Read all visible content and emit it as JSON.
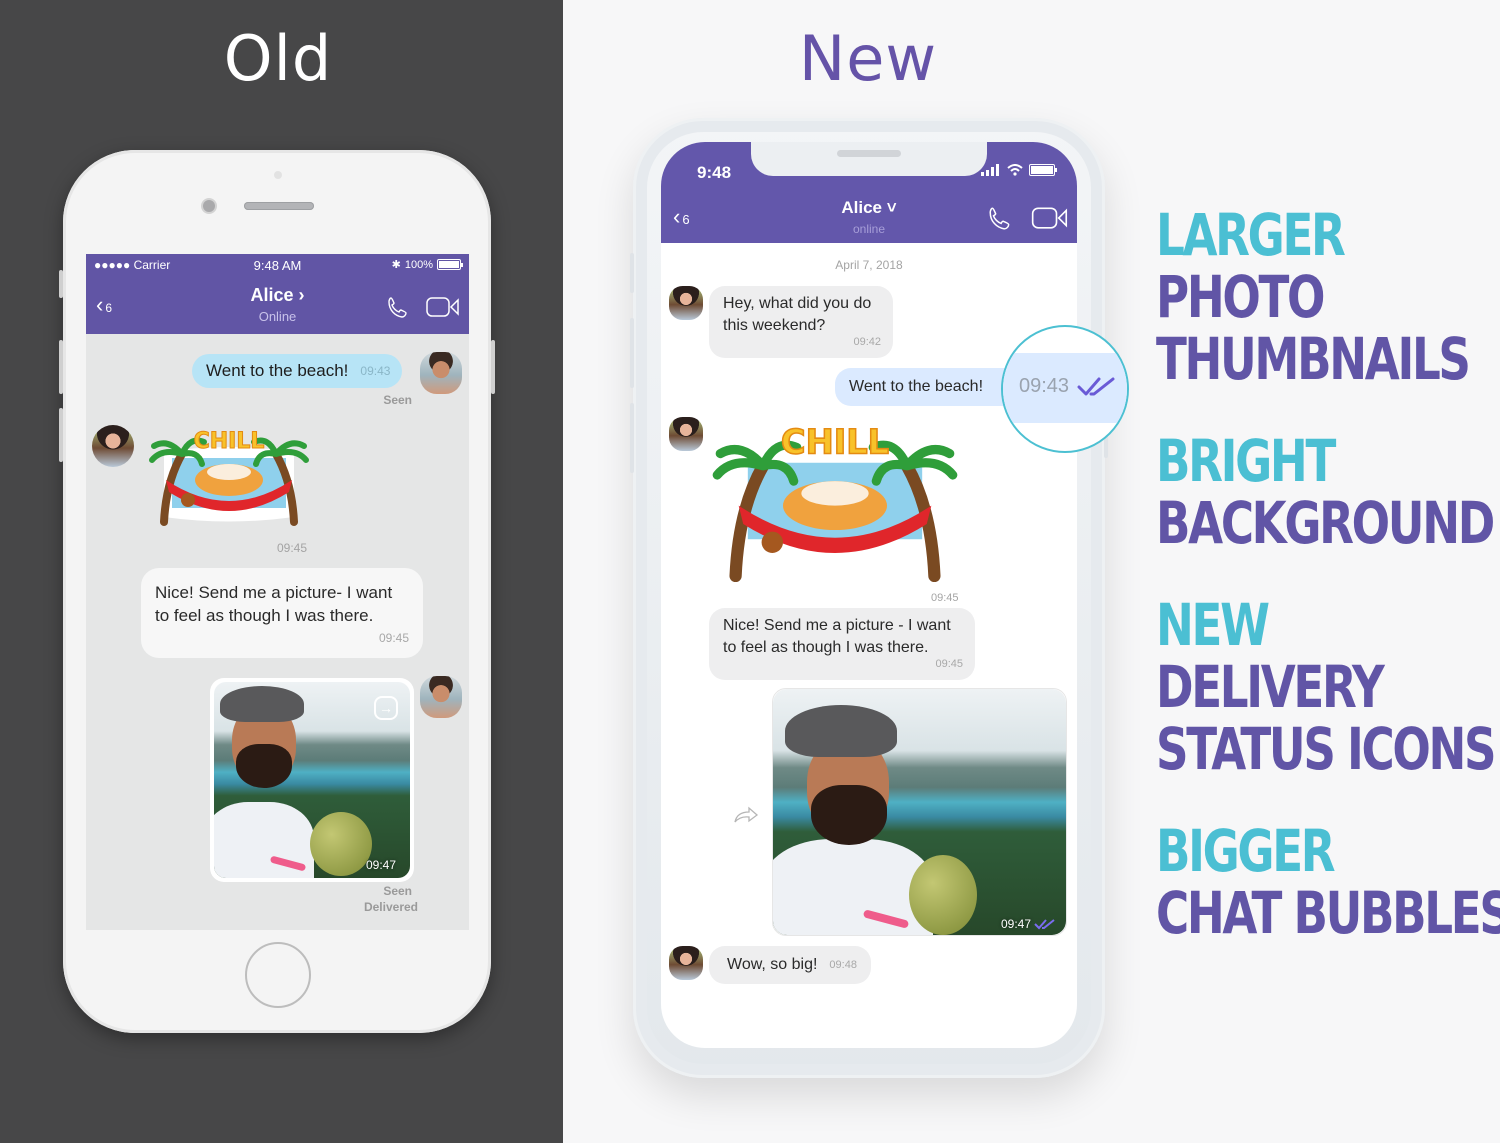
{
  "old": {
    "title": "Old",
    "statusbar": {
      "carrier": "●●●●● Carrier",
      "time": "9:48 AM",
      "bluetooth": "✱",
      "battery": "100%"
    },
    "navbar": {
      "back_count": "6",
      "contact": "Alice ›",
      "status": "Online"
    },
    "messages": [
      {
        "type": "text",
        "direction": "out",
        "text": "Went to the beach!",
        "time": "09:43",
        "status": "Seen"
      },
      {
        "type": "sticker",
        "direction": "in",
        "sticker": "CHILL",
        "time": "09:45"
      },
      {
        "type": "text",
        "direction": "in",
        "text": "Nice! Send me a picture- I want to feel as though I was there.",
        "time": "09:45"
      },
      {
        "type": "photo",
        "direction": "out",
        "time": "09:47",
        "status_lines": [
          "Seen",
          "Delivered"
        ]
      }
    ]
  },
  "new": {
    "title": "New",
    "statusbar": {
      "time": "9:48"
    },
    "navbar": {
      "back_count": "6",
      "contact": "Alice ˅",
      "status": "online"
    },
    "date_separator": "April 7, 2018",
    "messages": [
      {
        "type": "text",
        "direction": "in",
        "text": "Hey, what did you do this weekend?",
        "time": "09:42"
      },
      {
        "type": "text",
        "direction": "out",
        "text": "Went to the beach!",
        "time": "09:43",
        "status": "seen-double-check"
      },
      {
        "type": "sticker",
        "direction": "in",
        "sticker": "CHILL",
        "time": "09:45"
      },
      {
        "type": "text",
        "direction": "in",
        "text": "Nice! Send me a picture - I want to feel as though I was there.",
        "time": "09:45"
      },
      {
        "type": "photo",
        "direction": "out",
        "time": "09:47",
        "status": "seen-double-check"
      },
      {
        "type": "text",
        "direction": "in",
        "text": "Wow, so big!",
        "time": "09:48"
      }
    ],
    "magnifier": {
      "time": "09:43"
    }
  },
  "features": [
    {
      "accent": "LARGER",
      "lines": [
        "PHOTO",
        "THUMBNAILS"
      ]
    },
    {
      "accent": "BRIGHT",
      "lines": [
        "BACKGROUND"
      ]
    },
    {
      "accent": "NEW",
      "lines": [
        "DELIVERY",
        "STATUS ICONS"
      ]
    },
    {
      "accent": "BIGGER",
      "lines": [
        "CHAT BUBBLES"
      ]
    }
  ],
  "colors": {
    "viber_purple": "#6357ab",
    "accent_cyan": "#4bbfd3",
    "old_bg": "#474748",
    "new_bg": "#f7f7f8",
    "old_out_bubble": "#b7e4f6",
    "new_out_bubble": "#dbeaff",
    "check_color": "#6a5bd6"
  }
}
